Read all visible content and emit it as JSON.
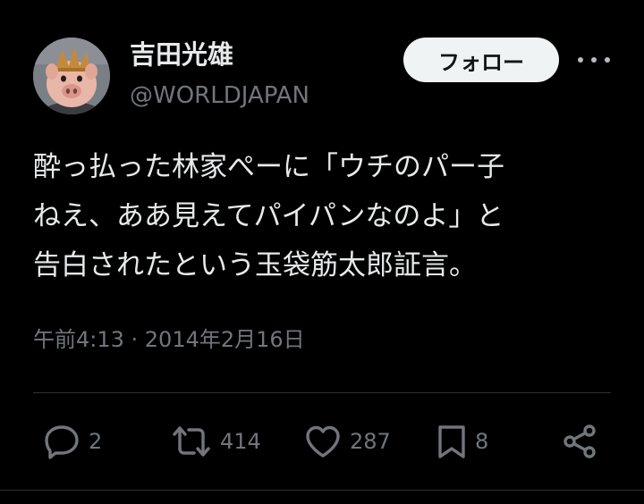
{
  "author": {
    "display_name": "吉田光雄",
    "handle": "@WORLDJAPAN"
  },
  "follow_label": "フォロー",
  "tweet": {
    "lines": [
      "酔っ払った林家ぺーに「ウチのパー子",
      "ねえ、ああ見えてパイパンなのよ」と",
      "告白されたという玉袋筋太郎証言。"
    ],
    "timestamp": "午前4:13 · 2014年2月16日"
  },
  "actions": {
    "replies": "2",
    "retweets": "414",
    "likes": "287",
    "bookmarks": "8"
  },
  "icons": [
    "reply-icon",
    "retweet-icon",
    "like-icon",
    "bookmark-icon",
    "share-icon",
    "more-icon"
  ],
  "colors": {
    "background": "#000000",
    "primary_text": "#e7e9ea",
    "secondary_text": "#71767b",
    "follow_button_bg": "#eff3f4",
    "divider": "#2f3336"
  }
}
